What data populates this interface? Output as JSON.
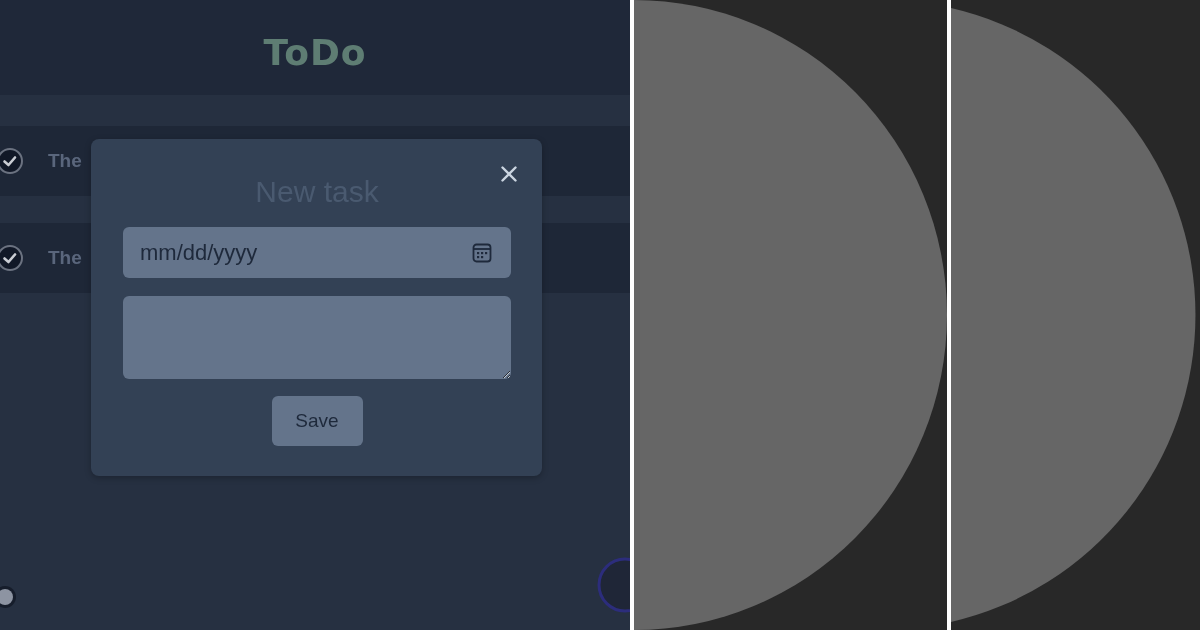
{
  "header": {
    "title": "ToDo"
  },
  "tasks": [
    {
      "text": "The",
      "done": true
    },
    {
      "text": "The",
      "done": true
    }
  ],
  "dialog": {
    "title": "New task",
    "date_field": {
      "placeholder": "mm/dd/yyyy"
    },
    "save_button": "Save"
  },
  "toggle": {
    "on": false
  }
}
